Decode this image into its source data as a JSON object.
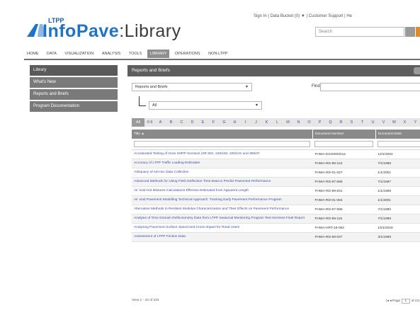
{
  "header": {
    "util_links": "Sign In | Data Bucket (0) ▼ | Customer Support | He",
    "ltpp": "LTPP",
    "brand": "InfoPave",
    "separator": ":",
    "library": "Library",
    "search_placeholder": "Search"
  },
  "nav": {
    "items": [
      "HOME",
      "DATA",
      "VISUALIZATION",
      "ANALYSIS",
      "TOOLS",
      "LIBRARY",
      "OPERATIONS",
      "NON-LTPP"
    ],
    "active": "LIBRARY"
  },
  "sidebar": {
    "items": [
      "Library",
      "What's New",
      "Reports and Briefs",
      "Program Documentation"
    ]
  },
  "panel": {
    "title": "Reports and Briefs",
    "category_select": "Reports and Briefs",
    "sub_select": "All",
    "find_label": "Find"
  },
  "alpha": [
    "All",
    "0-9",
    "A",
    "B",
    "C",
    "D",
    "E",
    "F",
    "G",
    "H",
    "I",
    "J",
    "K",
    "L",
    "M",
    "N",
    "O",
    "P",
    "Q",
    "R",
    "S",
    "T",
    "U",
    "V",
    "W",
    "X",
    "Y"
  ],
  "table": {
    "columns": [
      "Title ▲",
      "Document Number",
      "Document Date"
    ],
    "rows": [
      {
        "title": "Accelerated Testing of Gore SHRP Sections (SR 601, 240/152, 220/131 and 368/37",
        "number": "FHWA-DX/2006/012",
        "date": "12/1/2004"
      },
      {
        "title": "Accuracy of LTPP Traffic Loading Estimates",
        "number": "FHWA-RD-98-124",
        "date": "7/1/1998"
      },
      {
        "title": "Adequacy of Ad-Hoc Data Collection",
        "number": "FHWA-RD-01-027",
        "date": "1/1/2001"
      },
      {
        "title": "Advanced Methods for Using FWD Deflection Time-Data to Predict Pavement Performance",
        "number": "FHWA-RD-97-085",
        "date": "7/1/1997"
      },
      {
        "title": "Air Void Hot Mixtures Calculations Effective Estimated from Apparent Length",
        "number": "FHWA-RD-99-031",
        "date": "1/1/1999"
      },
      {
        "title": "Air Void Pavement Modelling Technical Approach: Tracking Early Pavement Performance Program",
        "number": "FHWA-RD-01-094",
        "date": "1/1/2001"
      },
      {
        "title": "Alternative Methods to Resilient Modulus Characterization and Their Effects on Pavement Performance",
        "number": "FHWA-RD-97-086",
        "date": "7/1/1990"
      },
      {
        "title": "Analysis of Time Domain Reflectometry Data from LTPP Seasonal Monitoring Program Test Sections Final Report",
        "number": "FHWA-RD-99-115",
        "date": "7/1/1999"
      },
      {
        "title": "Analyzing Pavement Surface Speed and Cross Impact for Road Users",
        "number": "FHWA-HRT-18-062",
        "date": "10/1/2018"
      },
      {
        "title": "Assessment of LTPP Friction Data",
        "number": "FHWA-RD-99-037",
        "date": "3/1/1999"
      }
    ]
  },
  "pager": {
    "summary": "View 1 - 10 of 224",
    "page_label": "Page",
    "page_value": "1",
    "of_label": "of 23"
  },
  "colors": {
    "brand_blue": "#1f72c4",
    "nav_active": "#8e8e8e",
    "panel_header": "#5e5e5e",
    "link": "#3a4fa8",
    "search_accent": "#e58a2a"
  }
}
